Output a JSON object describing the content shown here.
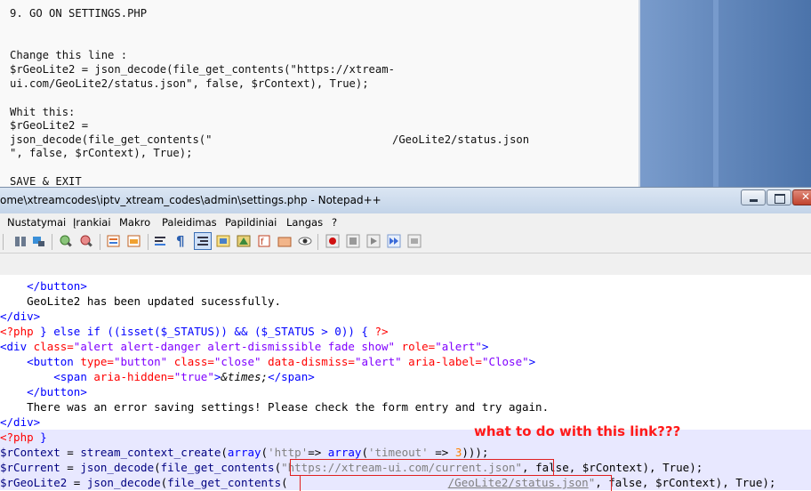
{
  "document": {
    "lines": [
      "9. GO ON SETTINGS.PHP",
      "Change this line :",
      "$rGeoLite2 = json_decode(file_get_contents(\"https://xtream-",
      "ui.com/GeoLite2/status.json\", false, $rContext), True);",
      "Whit this:",
      "$rGeoLite2 =",
      "json_decode(file_get_contents(\"",
      "/GeoLite2/status.json",
      "\", false, $rContext), True);",
      "SAVE & EXIT"
    ]
  },
  "window": {
    "title": "ome\\xtreamcodes\\iptv_xtream_codes\\admin\\settings.php - Notepad++"
  },
  "menu": [
    "Nustatymai",
    "Įrankiai",
    "Makro",
    "Paleidimas",
    "Papildiniai",
    "Langas",
    "?"
  ],
  "toolbar_icons": [
    "sync-v-icon",
    "sync-h-icon",
    "zoom-in-icon",
    "zoom-out-icon",
    "doc-map-icon",
    "doc-switch-icon",
    "wrap-icon",
    "pilcrow-icon",
    "indent-guide-icon",
    "lang-icon",
    "function-list-icon",
    "folder-as-workspace-icon",
    "doc-list-icon",
    "monitor-icon",
    "record-icon",
    "stop-icon",
    "play-icon",
    "run-multiple-icon",
    "save-macro-icon"
  ],
  "annotation": "what to do with this link???",
  "code": {
    "l1_close_button": "</button>",
    "l2_text": "GeoLite2 has been updated sucessfully.",
    "l3_close_div": "</div>",
    "l4_php_open": "<?php",
    "l4_else": "} else if ((isset($_STATUS)) && ($_STATUS > 0)) {",
    "l4_php_close": "?>",
    "l5_div": "<div",
    "l5_attr": "class=",
    "l5_val": "\"alert alert-danger alert-dismissible fade show\"",
    "l5_attr2": "role=",
    "l5_val2": "\"alert\"",
    "l5_gt": ">",
    "l6_button": "<button",
    "l6_attr1": "type=",
    "l6_val1": "\"button\"",
    "l6_attr2": "class=",
    "l6_val2": "\"close\"",
    "l6_attr3": "data-dismiss=",
    "l6_val3": "\"alert\"",
    "l6_attr4": "aria-label=",
    "l6_val4": "\"Close\"",
    "l6_gt": ">",
    "l7_span": "<span",
    "l7_attr": "aria-hidden=",
    "l7_val": "\"true\"",
    "l7_gt": ">",
    "l7_entity": "&times;",
    "l7_end": "</span>",
    "l8_close_button": "</button>",
    "l9_text": "There was an error saving settings! Please check the form entry and try again.",
    "l10_close_div": "</div>",
    "l11_php": "<?php",
    "l11_brace": "}",
    "l12_var": "$rContext",
    "l12_eq": " = ",
    "l12_fn": "stream_context_create",
    "l12_p1": "(",
    "l12_arr": "array",
    "l12_p2": "(",
    "l12_s1": "'http'",
    "l12_arrow": "=> ",
    "l12_arr2": "array",
    "l12_p3": "(",
    "l12_s2": "'timeout'",
    "l12_arrow2": " => ",
    "l12_num": "3",
    "l12_end": ")));",
    "l13_var": "$rCurrent",
    "l13_eq": " = ",
    "l13_fn": "json_decode",
    "l13_p": "(",
    "l13_fn2": "file_get_contents",
    "l13_p2": "(",
    "l13_url": "\"https://xtream-ui.com/current.json\"",
    "l13_rest": ", false, $rContext), True);",
    "l14_var": "$rGeoLite2",
    "l14_eq": " = ",
    "l14_fn": "json_decode",
    "l14_p": "(",
    "l14_fn2": "file_get_contents",
    "l14_p2": "(",
    "l14_path": "/GeoLite2/status.json",
    "l14_q": "\"",
    "l14_rest": ", false, $rContext), True);"
  }
}
